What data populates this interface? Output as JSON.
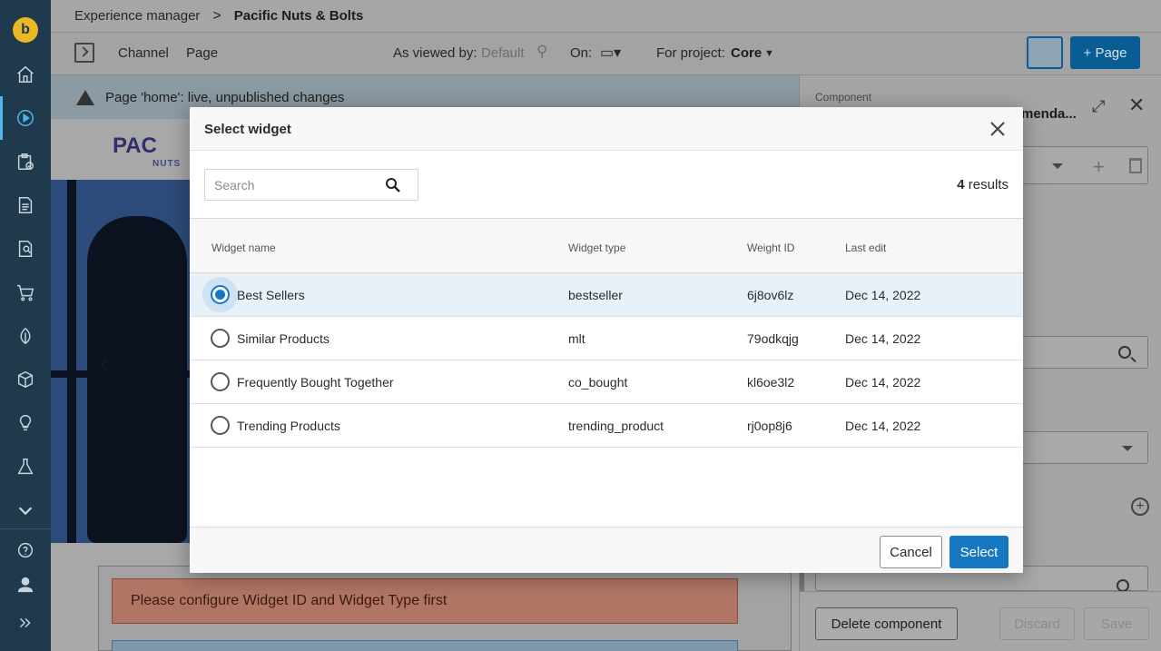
{
  "topbar": {
    "crumb_root": "Experience manager",
    "crumb_sep": ">",
    "crumb_current": "Pacific Nuts & Bolts"
  },
  "toolbar": {
    "channel": "Channel",
    "page": "Page",
    "viewed_by_label": "As viewed by:",
    "viewed_by_value": "Default",
    "on_label": "On:",
    "project_label": "For project:",
    "project_value": "Core",
    "new_page_label": "+ Page"
  },
  "preview": {
    "status": "Page 'home': live, unpublished changes",
    "brand": "PAC",
    "brand_sub": "NUTS",
    "error_message": "Please configure Widget ID and Widget Type first"
  },
  "rpanel": {
    "component_label": "Component",
    "component_title": "menda...",
    "delete_label": "Delete component",
    "discard_label": "Discard",
    "save_label": "Save"
  },
  "modal": {
    "title": "Select widget",
    "search_placeholder": "Search",
    "results_count": "4",
    "results_suffix": " results",
    "columns": {
      "name": "Widget name",
      "type": "Widget type",
      "weight": "Weight ID",
      "edit": "Last edit"
    },
    "rows": [
      {
        "name": "Best Sellers",
        "type": "bestseller",
        "weight": "6j8ov6lz",
        "edit": "Dec 14, 2022",
        "selected": true
      },
      {
        "name": "Similar Products",
        "type": "mlt",
        "weight": "79odkqjg",
        "edit": "Dec 14, 2022",
        "selected": false
      },
      {
        "name": "Frequently Bought Together",
        "type": "co_bought",
        "weight": "kl6oe3l2",
        "edit": "Dec 14, 2022",
        "selected": false
      },
      {
        "name": "Trending Products",
        "type": "trending_product",
        "weight": "rj0op8j6",
        "edit": "Dec 14, 2022",
        "selected": false
      }
    ],
    "cancel_label": "Cancel",
    "select_label": "Select"
  },
  "colors": {
    "accent": "#1678c2",
    "rail": "#1e3a4c",
    "selected_row": "#e8f1f8",
    "error_bg": "#b07565"
  },
  "icons": [
    "home-icon",
    "play-icon",
    "clipboard-icon",
    "document-icon",
    "search-doc-icon",
    "cart-icon",
    "leaf-icon",
    "cube-icon",
    "bulb-icon",
    "flask-icon",
    "chevron-down-icon",
    "help-icon",
    "user-icon",
    "expand-rail-icon",
    "search-icon",
    "close-icon",
    "radio-icon"
  ]
}
